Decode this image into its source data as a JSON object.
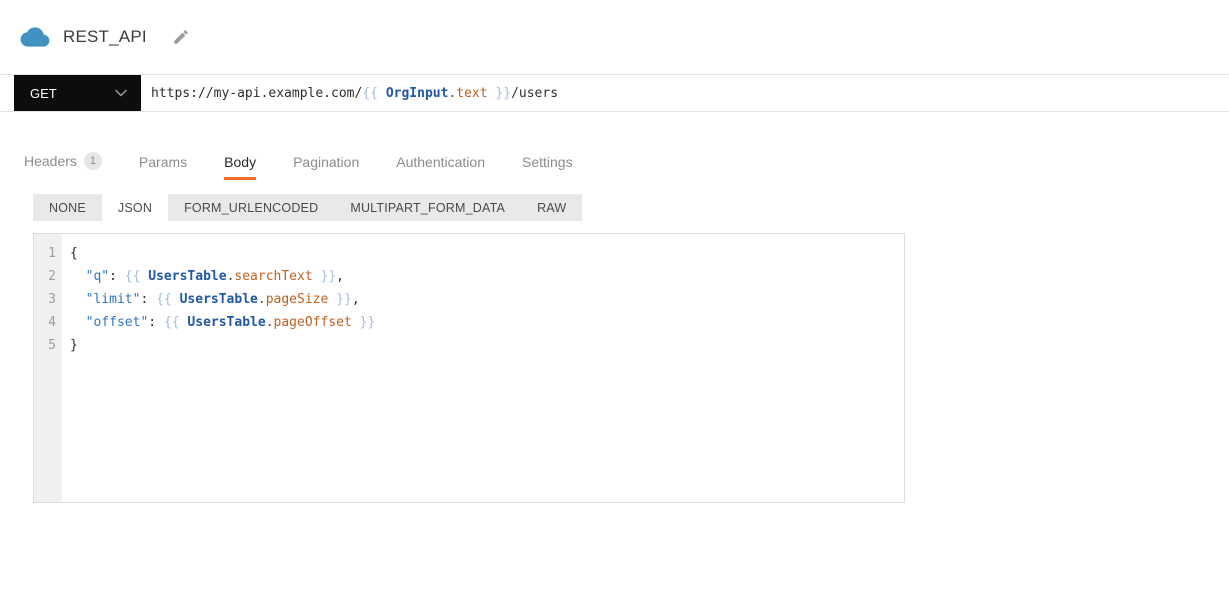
{
  "colors": {
    "accent_orange": "#ED6C2F",
    "method_button_bg": "#0D0D0D",
    "cloud_icon_blue": "#4292C1",
    "token_key_blue": "#2E74C0",
    "token_component_blue": "#2057A7",
    "token_property_orange": "#C2601F",
    "token_brace_lightblue": "#A6BDDF"
  },
  "header": {
    "title": "REST_API",
    "resource_icon": "cloud-icon",
    "edit_icon": "pencil-icon"
  },
  "request_bar": {
    "method": "GET",
    "url_tokens": [
      {
        "text": "https://my-api.example.com/",
        "type": "plain"
      },
      {
        "text": "{{ ",
        "type": "brace"
      },
      {
        "text": "OrgInput",
        "type": "component"
      },
      {
        "text": ".",
        "type": "punct"
      },
      {
        "text": "text",
        "type": "property"
      },
      {
        "text": " }}",
        "type": "brace"
      },
      {
        "text": "/users",
        "type": "plain"
      }
    ]
  },
  "tabs": [
    {
      "label": "Headers",
      "badge": "1",
      "active": false
    },
    {
      "label": "Params",
      "active": false
    },
    {
      "label": "Body",
      "active": true
    },
    {
      "label": "Pagination",
      "active": false
    },
    {
      "label": "Authentication",
      "active": false
    },
    {
      "label": "Settings",
      "active": false
    }
  ],
  "body_mode_tabs": [
    {
      "label": "NONE",
      "active": false
    },
    {
      "label": "JSON",
      "active": true
    },
    {
      "label": "FORM_URLENCODED",
      "active": false
    },
    {
      "label": "MULTIPART_FORM_DATA",
      "active": false
    },
    {
      "label": "RAW",
      "active": false
    }
  ],
  "editor": {
    "lines": [
      {
        "number": "1",
        "tokens": [
          {
            "text": "{",
            "type": "plain"
          }
        ]
      },
      {
        "number": "2",
        "tokens": [
          {
            "text": "  ",
            "type": "plain"
          },
          {
            "text": "\"q\"",
            "type": "key"
          },
          {
            "text": ": ",
            "type": "plain"
          },
          {
            "text": "{{ ",
            "type": "brace"
          },
          {
            "text": "UsersTable",
            "type": "component"
          },
          {
            "text": ".",
            "type": "punct"
          },
          {
            "text": "searchText",
            "type": "property"
          },
          {
            "text": " }}",
            "type": "brace"
          },
          {
            "text": ",",
            "type": "plain"
          }
        ]
      },
      {
        "number": "3",
        "tokens": [
          {
            "text": "  ",
            "type": "plain"
          },
          {
            "text": "\"limit\"",
            "type": "key"
          },
          {
            "text": ": ",
            "type": "plain"
          },
          {
            "text": "{{ ",
            "type": "brace"
          },
          {
            "text": "UsersTable",
            "type": "component"
          },
          {
            "text": ".",
            "type": "punct"
          },
          {
            "text": "pageSize",
            "type": "property"
          },
          {
            "text": " }}",
            "type": "brace"
          },
          {
            "text": ",",
            "type": "plain"
          }
        ]
      },
      {
        "number": "4",
        "tokens": [
          {
            "text": "  ",
            "type": "plain"
          },
          {
            "text": "\"offset\"",
            "type": "key"
          },
          {
            "text": ": ",
            "type": "plain"
          },
          {
            "text": "{{ ",
            "type": "brace"
          },
          {
            "text": "UsersTable",
            "type": "component"
          },
          {
            "text": ".",
            "type": "punct"
          },
          {
            "text": "pageOffset",
            "type": "property"
          },
          {
            "text": " }}",
            "type": "brace"
          }
        ]
      },
      {
        "number": "5",
        "tokens": [
          {
            "text": "}",
            "type": "plain"
          }
        ]
      }
    ]
  }
}
